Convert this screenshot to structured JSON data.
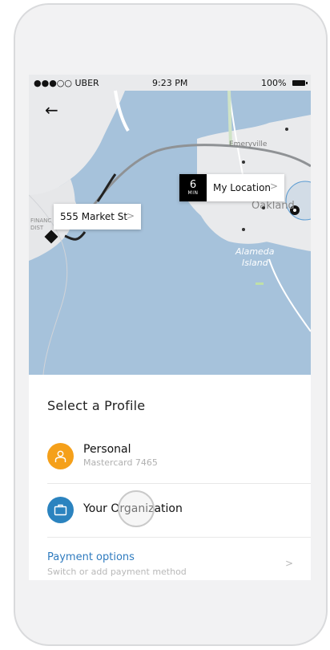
{
  "status_bar": {
    "carrier": "●●●○○ UBER",
    "time": "9:23 PM",
    "battery": "100%"
  },
  "map": {
    "labels": {
      "emeryville": "Emeryville",
      "oakland": "Oakland",
      "alameda": "Alameda",
      "island": "Island",
      "financial": "FINANC",
      "district": "DIST"
    },
    "destination_pin": {
      "label": "555 Market St",
      "chevron": ">"
    },
    "location_pin": {
      "eta_value": "6",
      "eta_unit": "MIN",
      "label": "My Location",
      "chevron": ">"
    }
  },
  "sheet": {
    "title": "Select a Profile",
    "profiles": [
      {
        "name": "Personal",
        "subtitle": "Mastercard 7465",
        "icon": "person-icon",
        "color": "#f5a01a"
      },
      {
        "name": "Your Organization",
        "icon": "briefcase-icon",
        "color": "#2b83bf"
      }
    ],
    "payment": {
      "title": "Payment options",
      "subtitle": "Switch or add payment method",
      "chevron": ">"
    }
  },
  "colors": {
    "water": "#a6c2db",
    "land": "#e9eaec",
    "accent_blue": "#2f7bbf"
  }
}
